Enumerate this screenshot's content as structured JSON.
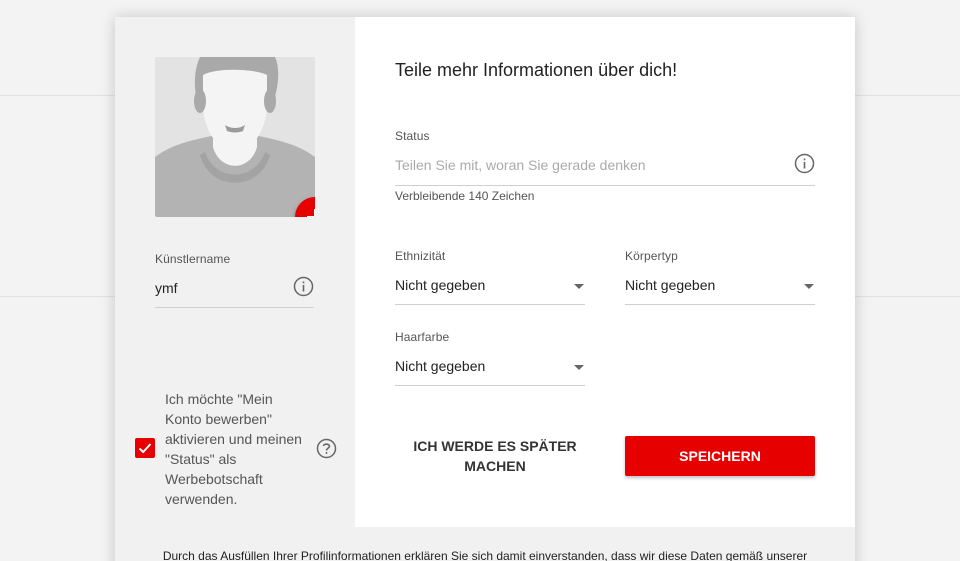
{
  "profile": {
    "avatar_add_icon": "plus-icon",
    "artist_name_label": "Künstlername",
    "artist_name_value": "ymf",
    "promo_checkbox_checked": true,
    "promo_text": "Ich möchte \"Mein Konto bewerben\" aktivieren und meinen \"Status\" als Werbebotschaft verwenden."
  },
  "form": {
    "heading": "Teile mehr Informationen über dich!",
    "status_label": "Status",
    "status_placeholder": "Teilen Sie mit, woran Sie gerade denken",
    "status_value": "",
    "remaining_chars": "Verbleibende 140 Zeichen",
    "ethnicity": {
      "label": "Ethnizität",
      "value": "Nicht gegeben"
    },
    "body_type": {
      "label": "Körpertyp",
      "value": "Nicht gegeben"
    },
    "hair_color": {
      "label": "Haarfarbe",
      "value": "Nicht gegeben"
    },
    "later_button": "ICH WERDE ES SPÄTER MACHEN",
    "save_button": "SPEICHERN"
  },
  "footer": {
    "consent_text": "Durch das Ausfüllen Ihrer Profilinformationen erklären Sie sich damit einverstanden, dass wir diese Daten gemäß unserer"
  },
  "colors": {
    "accent": "#e60000",
    "panel_left": "#f1f1f1",
    "panel_right": "#ffffff"
  }
}
